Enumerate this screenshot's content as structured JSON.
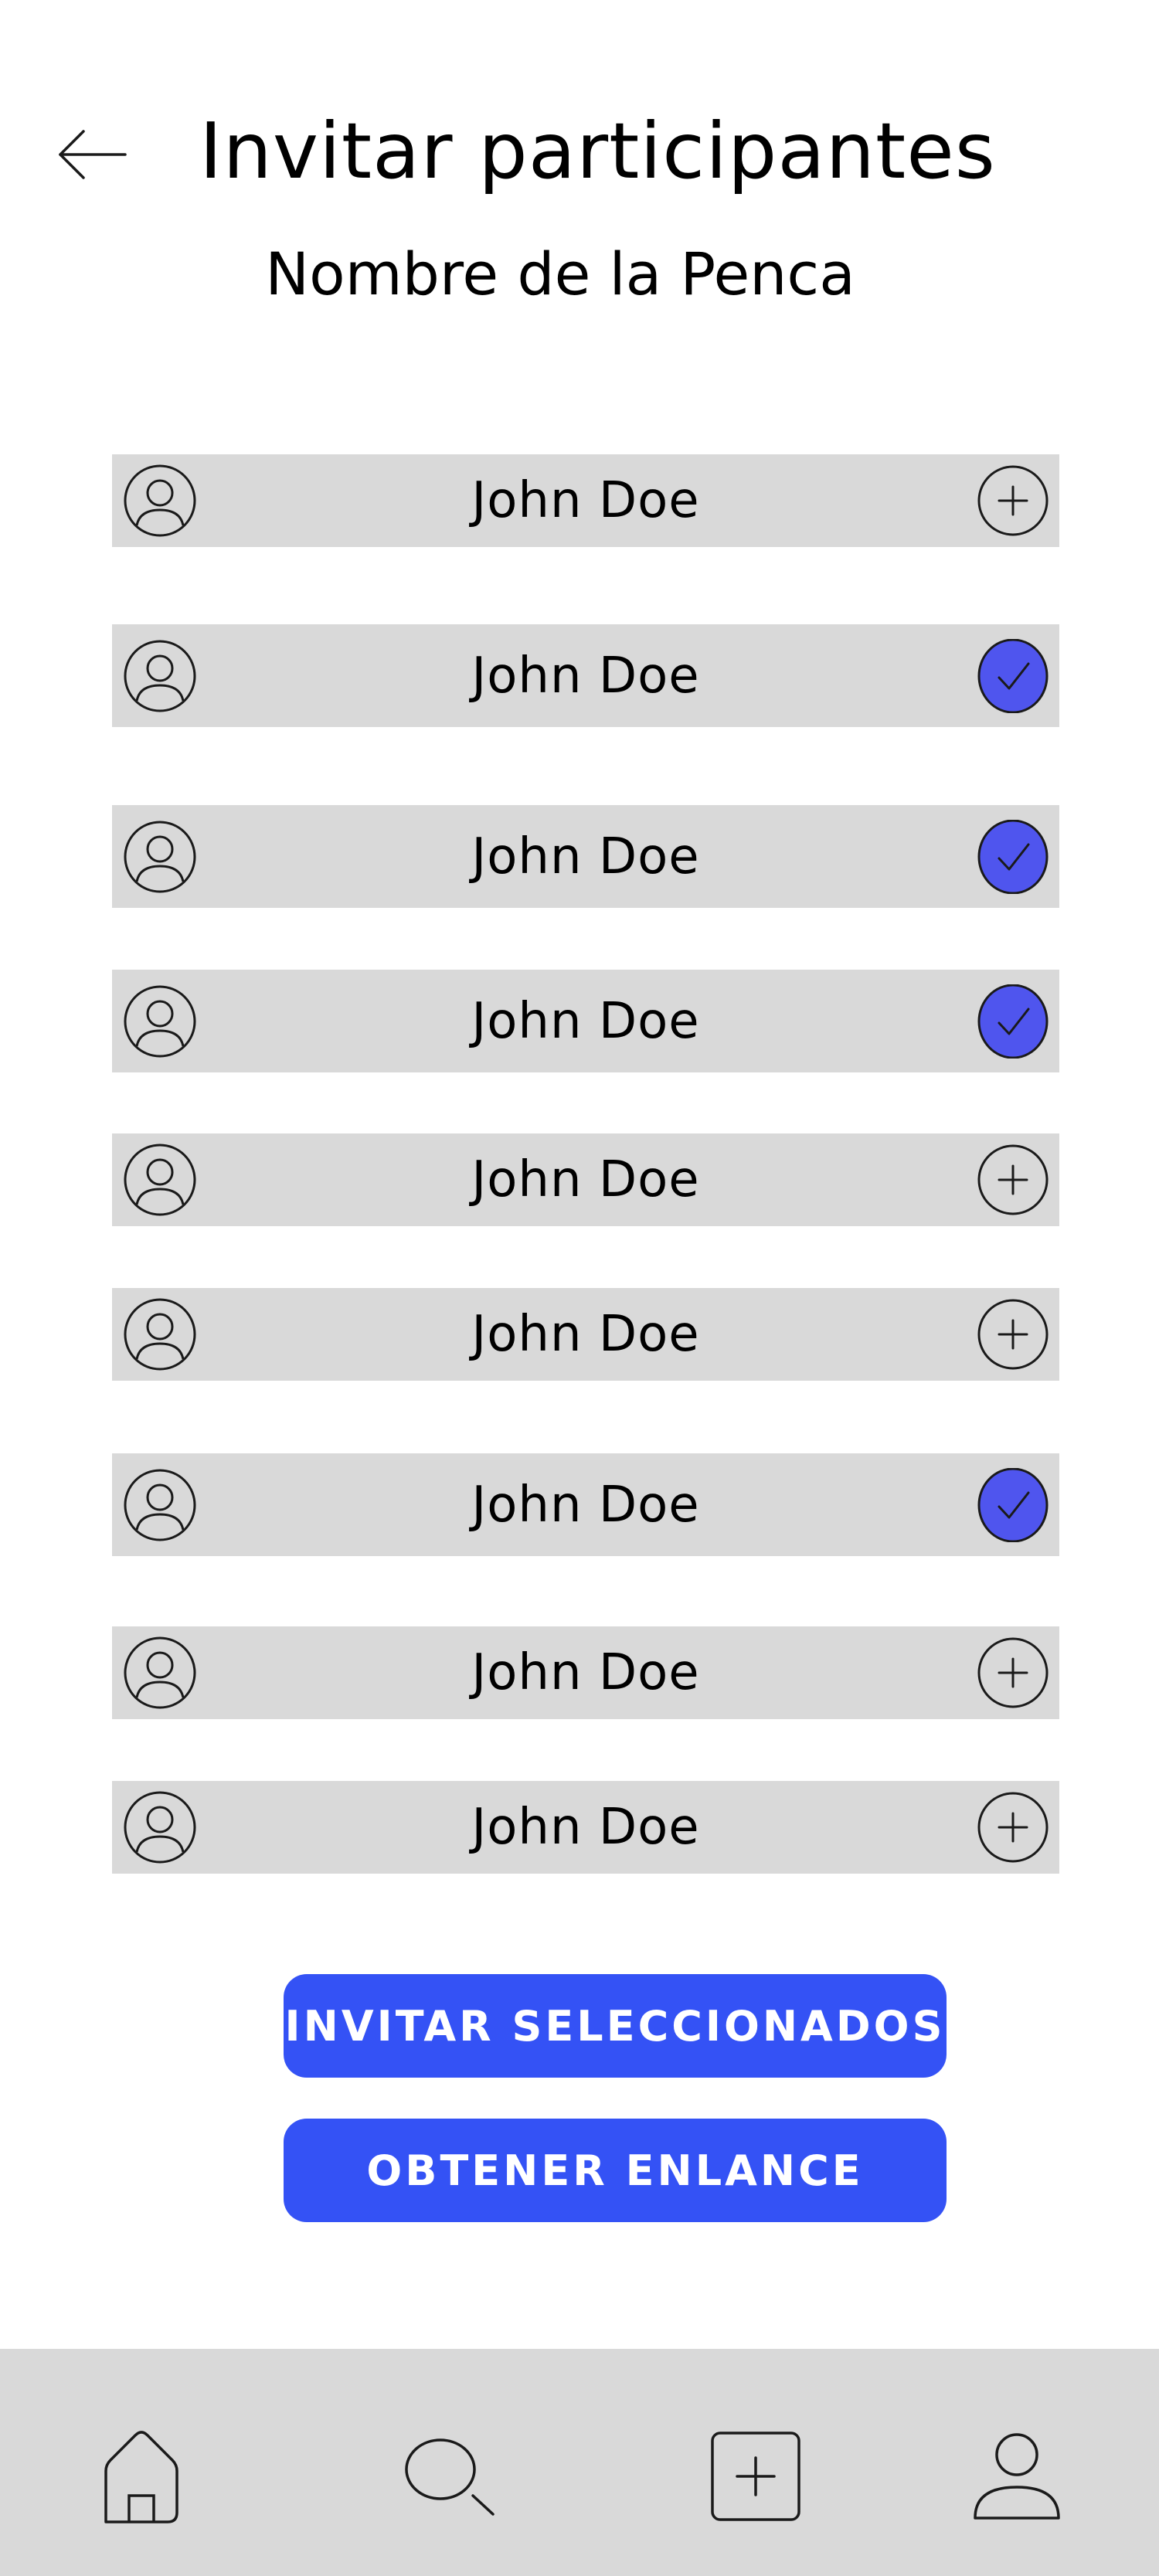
{
  "header": {
    "title": "Invitar participantes",
    "subtitle": "Nombre de la Penca"
  },
  "icons": {
    "back": "arrow-left-icon",
    "avatar": "user-circle-icon",
    "add": "plus-circle-icon",
    "selected": "check-circle-icon"
  },
  "participants": [
    {
      "name": "John Doe",
      "selected": false
    },
    {
      "name": "John Doe",
      "selected": true
    },
    {
      "name": "John Doe",
      "selected": true
    },
    {
      "name": "John Doe",
      "selected": true
    },
    {
      "name": "John Doe",
      "selected": false
    },
    {
      "name": "John Doe",
      "selected": false
    },
    {
      "name": "John Doe",
      "selected": true
    },
    {
      "name": "John Doe",
      "selected": false
    },
    {
      "name": "John Doe",
      "selected": false
    }
  ],
  "actions": {
    "invite_selected_label": "INVITAR SELECCIONADOS",
    "get_link_label": "OBTENER ENLANCE"
  },
  "bottom_nav": [
    {
      "id": "home",
      "icon": "home-icon"
    },
    {
      "id": "search",
      "icon": "search-icon"
    },
    {
      "id": "create",
      "icon": "plus-square-icon"
    },
    {
      "id": "profile",
      "icon": "user-icon"
    }
  ],
  "colors": {
    "row_background": "#d9d9d9",
    "nav_background": "#d9d9d9",
    "primary_button": "#3452f5",
    "selected_check": "#4f55ee",
    "text": "#000000"
  }
}
